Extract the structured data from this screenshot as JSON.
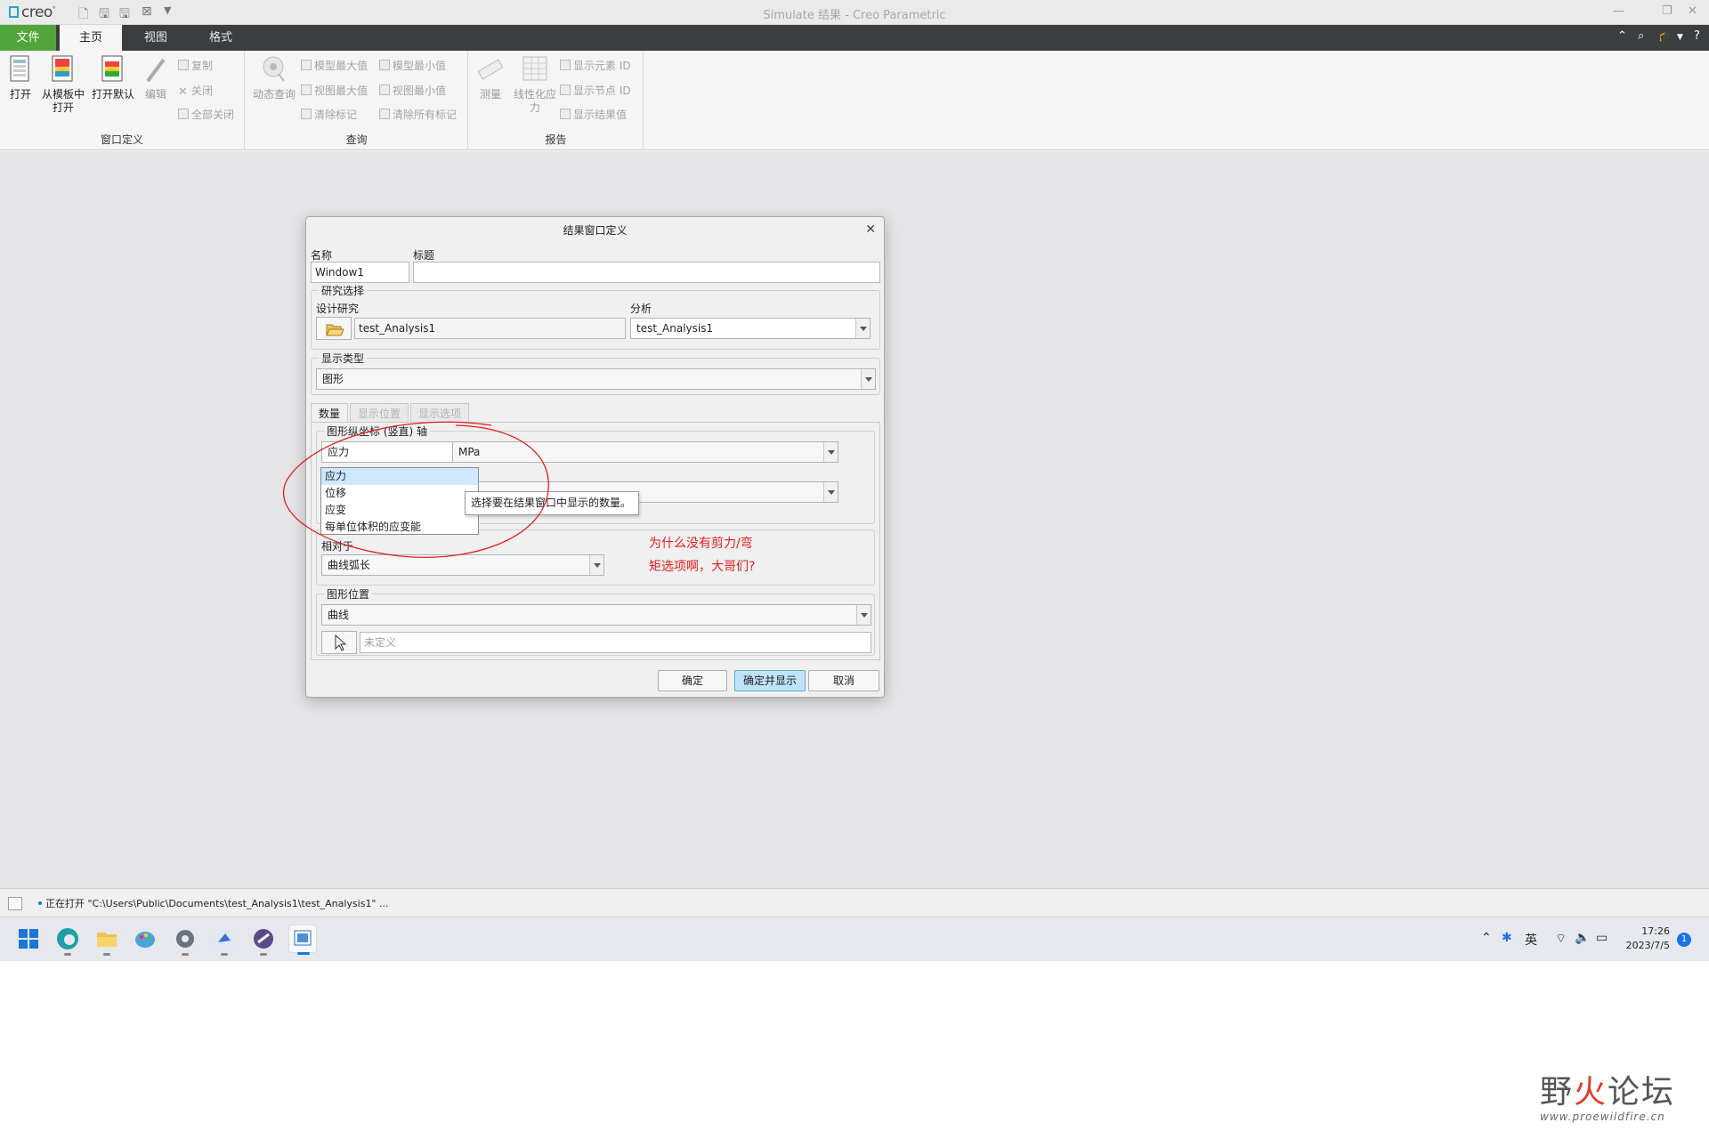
{
  "window": {
    "logo": "creo",
    "title": "Simulate 结果 - Creo Parametric"
  },
  "tabs": [
    {
      "label": "文件"
    },
    {
      "label": "主页"
    },
    {
      "label": "视图"
    },
    {
      "label": "格式"
    }
  ],
  "ribbon": {
    "window_def": {
      "label": "窗口定义",
      "open": "打开",
      "open_template_1": "从模板中",
      "open_template_2": "打开",
      "open_default": "打开默认",
      "edit": "编辑",
      "copy": "复制",
      "close": "关闭",
      "close_all": "全部关闭"
    },
    "query": {
      "label": "查询",
      "dynamic_query": "动态查询",
      "model_max": "模型最大值",
      "model_min": "模型最小值",
      "view_max": "视图最大值",
      "view_min": "视图最小值",
      "clear_marks": "清除标记",
      "clear_all_marks": "清除所有标记"
    },
    "report": {
      "label": "报告",
      "measure": "测量",
      "linearize_1": "线性化应",
      "linearize_2": "力",
      "show_element_id": "显示元素 ID",
      "show_node_id": "显示节点 ID",
      "show_result": "显示结果值"
    }
  },
  "dialog": {
    "title": "结果窗口定义",
    "name_label": "名称",
    "name_value": "Window1",
    "title_label": "标题",
    "title_value": "",
    "study_group": "研究选择",
    "design_study_label": "设计研究",
    "design_study_value": "test_Analysis1",
    "analysis_label": "分析",
    "analysis_value": "test_Analysis1",
    "display_type_group": "显示类型",
    "display_type_value": "图形",
    "tabs": [
      "数量",
      "显示位置",
      "显示选项"
    ],
    "y_axis_group": "图形纵坐标 (竖直) 轴",
    "quantity_value": "应力",
    "unit_value": "MPa",
    "dropdown_options": [
      "应力",
      "位移",
      "应变",
      "每单位体积的应变能"
    ],
    "tooltip": "选择要在结果窗口中显示的数量。",
    "relative_label": "相对于",
    "relative_value": "曲线弧长",
    "graph_location_group": "图形位置",
    "graph_location_value": "曲线",
    "location_placeholder": "未定义",
    "ok": "确定",
    "ok_show": "确定并显示",
    "cancel": "取消"
  },
  "annotation": {
    "line1": "为什么没有剪力/弯",
    "line2": "矩选项啊，大哥们?"
  },
  "status": {
    "message": "正在打开 \"C:\\Users\\Public\\Documents\\test_Analysis1\\test_Analysis1\" ..."
  },
  "taskbar": {
    "ime": "英",
    "time": "17:26",
    "date": "2023/7/5",
    "badge": "1"
  },
  "watermark": {
    "text_a": "野",
    "text_b": "火",
    "text_c": "论坛",
    "url": "www.proewildfire.cn"
  },
  "colors": {
    "file_tab": "#52a53b",
    "tab_bar": "#3b3e40",
    "annotation": "#e02020",
    "default_button": "#bfe4fa"
  }
}
